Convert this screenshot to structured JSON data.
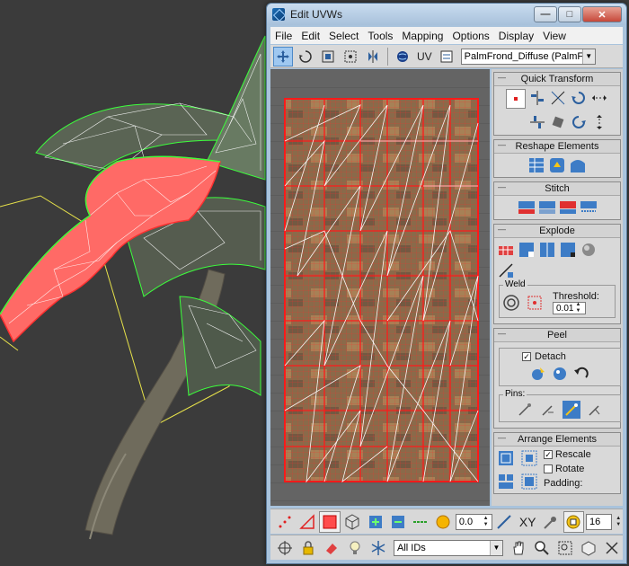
{
  "window": {
    "title": "Edit UVWs",
    "minimize": "—",
    "restore": "□",
    "close": "✕"
  },
  "menubar": [
    "File",
    "Edit",
    "Select",
    "Tools",
    "Mapping",
    "Options",
    "Display",
    "View"
  ],
  "toolbar": {
    "uv_label": "UV",
    "map_select": "PalmFrond_Diffuse (PalmFronc"
  },
  "rollouts": {
    "quick_transform": "Quick Transform",
    "reshape": "Reshape Elements",
    "stitch": "Stitch",
    "explode": "Explode",
    "weld_label": "Weld",
    "threshold_label": "Threshold:",
    "threshold_value": "0.01",
    "peel": "Peel",
    "detach_label": "Detach",
    "pins_label": "Pins:",
    "arrange": "Arrange Elements",
    "rescale_label": "Rescale",
    "rotate_label": "Rotate",
    "padding_label": "Padding:"
  },
  "checkbox_states": {
    "detach": true,
    "rescale": true,
    "rotate": false
  },
  "bottom": {
    "coord_value": "0.0",
    "xy_label": "XY",
    "zoom_value": "16",
    "ids_select": "All IDs"
  },
  "colors": {
    "selection": "#ff2020",
    "wire": "#ffffff",
    "element_fill": "#ff6a66",
    "green_outline": "#3cff3c",
    "gizmo_yellow": "#e7e24a"
  }
}
